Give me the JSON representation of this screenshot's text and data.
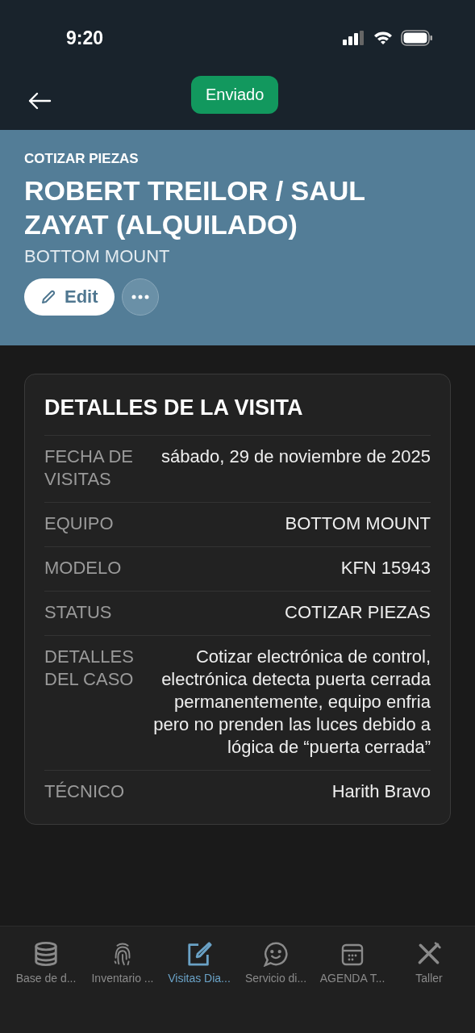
{
  "status_bar": {
    "time": "9:20"
  },
  "nav": {
    "badge": "Enviado"
  },
  "header": {
    "category": "COTIZAR PIEZAS",
    "title": "ROBERT TREILOR / SAUL ZAYAT (ALQUILADO)",
    "subtitle": "BOTTOM MOUNT",
    "edit_label": "Edit"
  },
  "card": {
    "title": "DETALLES DE LA VISITA",
    "rows": [
      {
        "label": "FECHA DE VISITAS",
        "value": "sábado, 29 de noviembre de 2025"
      },
      {
        "label": "EQUIPO",
        "value": "BOTTOM MOUNT"
      },
      {
        "label": "MODELO",
        "value": "KFN 15943"
      },
      {
        "label": "STATUS",
        "value": "COTIZAR PIEZAS"
      },
      {
        "label": "DETALLES DEL CASO",
        "value": "Cotizar electrónica de control, electrónica detecta puerta cerrada permanentemente, equipo enfria pero no prenden las luces debido a lógica de “puerta cerrada”"
      },
      {
        "label": "TÉCNICO",
        "value": "Harith Bravo"
      }
    ]
  },
  "tab_bar": [
    {
      "label": "Base de d...",
      "selected": false
    },
    {
      "label": "Inventario ...",
      "selected": false
    },
    {
      "label": "Visitas Dia...",
      "selected": true
    },
    {
      "label": "Servicio di...",
      "selected": false
    },
    {
      "label": "AGENDA T...",
      "selected": false
    },
    {
      "label": "Taller",
      "selected": false
    }
  ]
}
